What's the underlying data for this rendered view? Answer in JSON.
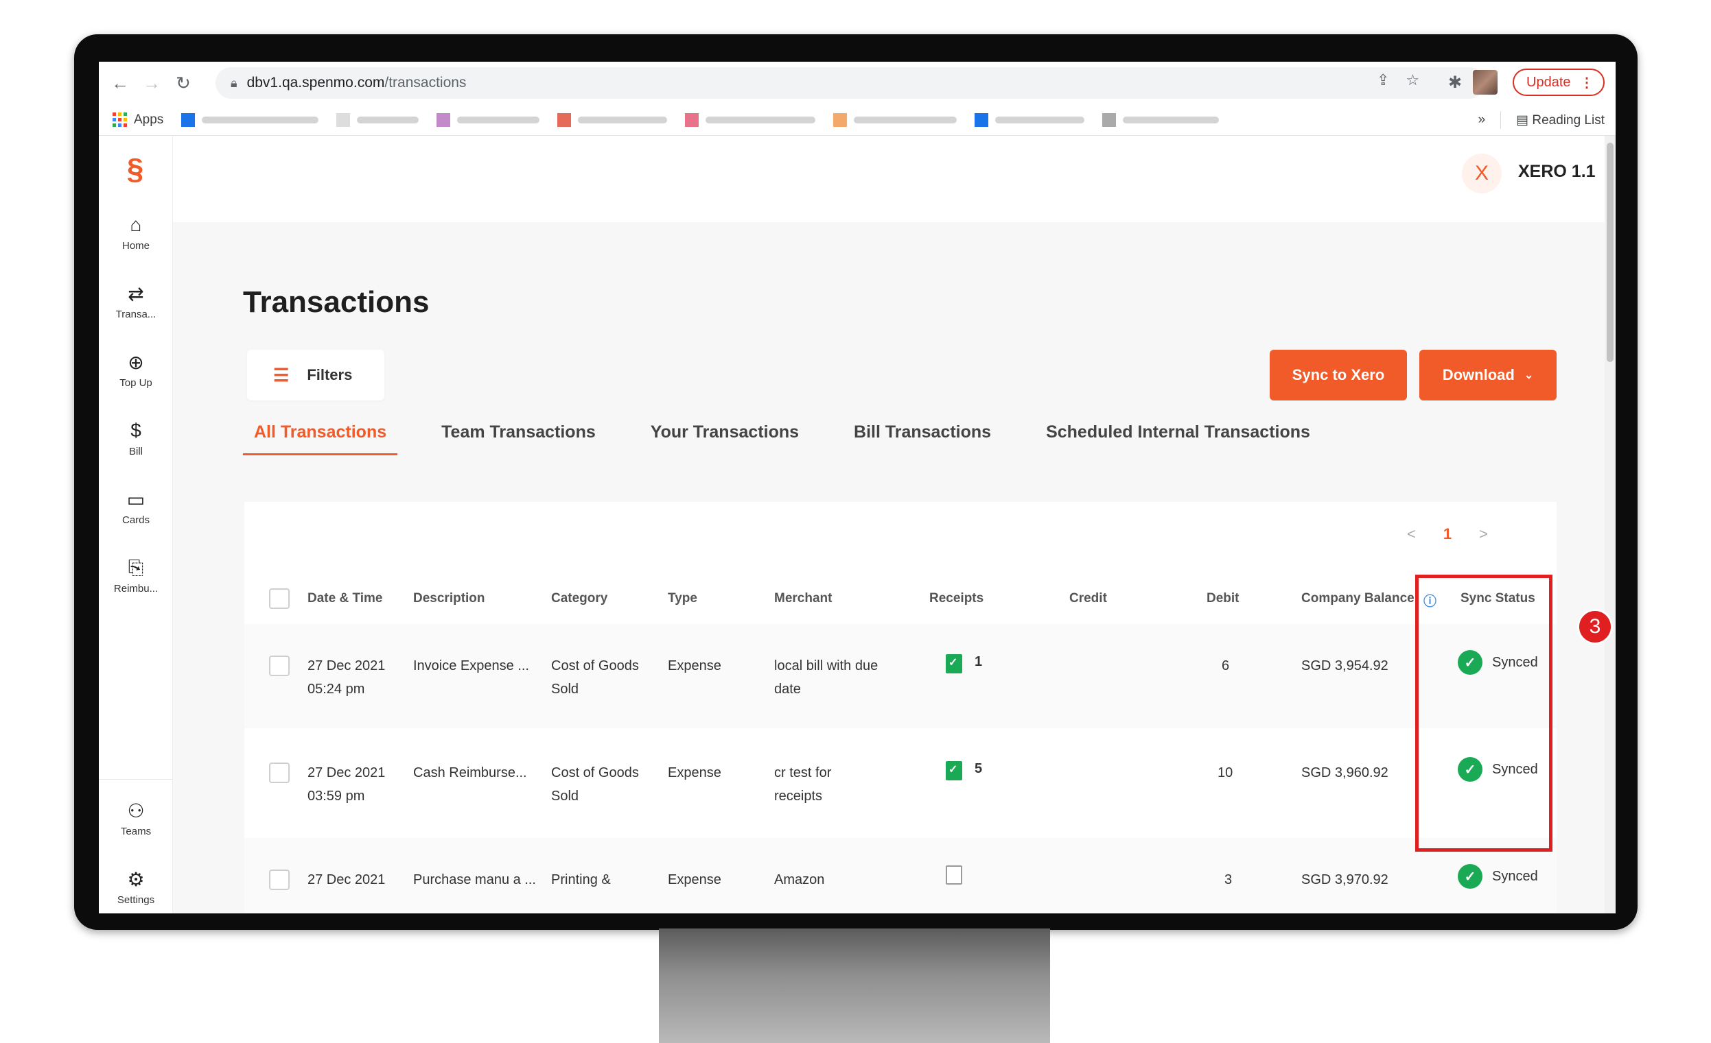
{
  "browser": {
    "url_host": "dbv1.qa.spenmo.com",
    "url_path": "/transactions",
    "update_label": "Update",
    "apps_label": "Apps",
    "overflow_label": "»",
    "reading_list_label": "Reading List"
  },
  "sidebar": {
    "items": [
      {
        "label": "Home",
        "icon": "home-icon"
      },
      {
        "label": "Transa...",
        "icon": "transfer-icon"
      },
      {
        "label": "Top Up",
        "icon": "top-up-icon"
      },
      {
        "label": "Bill",
        "icon": "bill-icon"
      },
      {
        "label": "Cards",
        "icon": "card-icon"
      },
      {
        "label": "Reimbu...",
        "icon": "reimburse-icon"
      },
      {
        "label": "Teams",
        "icon": "teams-icon"
      },
      {
        "label": "Settings",
        "icon": "gear-icon"
      }
    ]
  },
  "org": {
    "avatar": "X",
    "name": "XERO 1.1"
  },
  "page": {
    "title": "Transactions",
    "filters_label": "Filters",
    "sync_label": "Sync to Xero",
    "download_label": "Download"
  },
  "tabs": [
    {
      "label": "All Transactions",
      "active": true
    },
    {
      "label": "Team Transactions",
      "active": false
    },
    {
      "label": "Your Transactions",
      "active": false
    },
    {
      "label": "Bill Transactions",
      "active": false
    },
    {
      "label": "Scheduled Internal Transactions",
      "active": false
    }
  ],
  "pagination": {
    "prev": "<",
    "current": "1",
    "next": ">"
  },
  "table": {
    "columns": [
      "Date & Time",
      "Description",
      "Category",
      "Type",
      "Merchant",
      "Receipts",
      "Credit",
      "Debit",
      "Company Balance",
      "Sync Status"
    ],
    "rows": [
      {
        "date": "27 Dec 2021",
        "time": "05:24 pm",
        "description": "Invoice Expense ...",
        "category_1": "Cost of Goods",
        "category_2": "Sold",
        "type": "Expense",
        "merchant_1": "local bill with due",
        "merchant_2": "date",
        "receipts": "1",
        "has_receipt": true,
        "credit": "",
        "debit": "6",
        "balance": "SGD 3,954.92",
        "sync_status": "Synced"
      },
      {
        "date": "27 Dec 2021",
        "time": "03:59 pm",
        "description": "Cash Reimburse...",
        "category_1": "Cost of Goods",
        "category_2": "Sold",
        "type": "Expense",
        "merchant_1": "cr test for",
        "merchant_2": "receipts",
        "receipts": "5",
        "has_receipt": true,
        "credit": "",
        "debit": "10",
        "balance": "SGD 3,960.92",
        "sync_status": "Synced"
      },
      {
        "date": "27 Dec 2021",
        "time": "",
        "description": "Purchase manu a ...",
        "category_1": "Printing &",
        "category_2": "",
        "type": "Expense",
        "merchant_1": "Amazon",
        "merchant_2": "",
        "receipts": "",
        "has_receipt": false,
        "credit": "",
        "debit": "3",
        "balance": "SGD 3,970.92",
        "sync_status": "Synced"
      }
    ]
  },
  "annotation": {
    "step": "3"
  },
  "colors": {
    "brand": "#f15a29",
    "success": "#1aaa55",
    "highlight": "#e02020"
  }
}
